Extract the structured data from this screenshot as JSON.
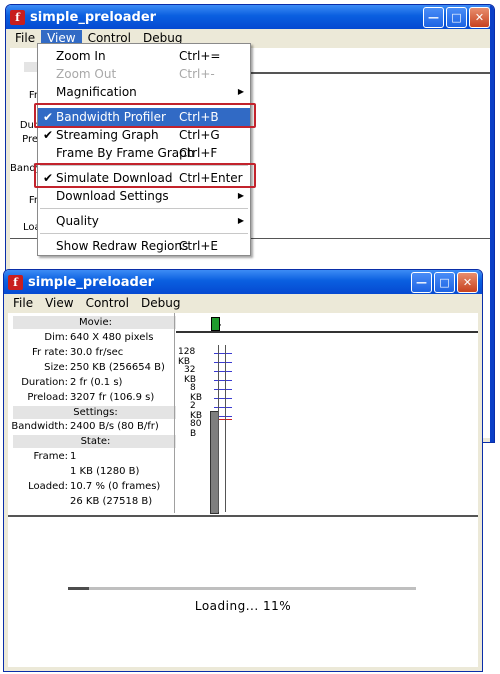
{
  "window": {
    "title": "simple_preloader",
    "menu": [
      "File",
      "View",
      "Control",
      "Debug"
    ]
  },
  "back_window": {
    "partial_labels": [
      "Fr",
      "Dur",
      "Pre",
      "Bandy",
      "Fr",
      "Loa"
    ]
  },
  "view_menu": {
    "items": [
      {
        "label": "Zoom In",
        "shortcut": "Ctrl+=",
        "checked": false,
        "disabled": false,
        "submenu": false
      },
      {
        "label": "Zoom Out",
        "shortcut": "Ctrl+-",
        "checked": false,
        "disabled": true,
        "submenu": false
      },
      {
        "label": "Magnification",
        "shortcut": "",
        "checked": false,
        "disabled": false,
        "submenu": true
      },
      {
        "label": "Bandwidth Profiler",
        "shortcut": "Ctrl+B",
        "checked": true,
        "disabled": false,
        "submenu": false,
        "highlighted": true
      },
      {
        "label": "Streaming Graph",
        "shortcut": "Ctrl+G",
        "checked": true,
        "disabled": false,
        "submenu": false
      },
      {
        "label": "Frame By Frame Graph",
        "shortcut": "Ctrl+F",
        "checked": false,
        "disabled": false,
        "submenu": false
      },
      {
        "label": "Simulate Download",
        "shortcut": "Ctrl+Enter",
        "checked": true,
        "disabled": false,
        "submenu": false
      },
      {
        "label": "Download Settings",
        "shortcut": "",
        "checked": false,
        "disabled": false,
        "submenu": true
      },
      {
        "label": "Quality",
        "shortcut": "",
        "checked": false,
        "disabled": false,
        "submenu": true
      },
      {
        "label": "Show Redraw Regions",
        "shortcut": "Ctrl+E",
        "checked": false,
        "disabled": false,
        "submenu": false
      }
    ]
  },
  "profiler": {
    "movie_header": "Movie:",
    "dim": {
      "label": "Dim:",
      "value": "640 X 480 pixels"
    },
    "fr_rate": {
      "label": "Fr rate:",
      "value": "30.0 fr/sec"
    },
    "size": {
      "label": "Size:",
      "value": "250 KB (256654 B)"
    },
    "duration": {
      "label": "Duration:",
      "value": "2 fr (0.1 s)"
    },
    "preload": {
      "label": "Preload:",
      "value": "3207 fr (106.9 s)"
    },
    "settings_header": "Settings:",
    "bandwidth": {
      "label": "Bandwidth:",
      "value": "2400 B/s (80 B/fr)"
    },
    "state_header": "State:",
    "frame": {
      "label": "Frame:",
      "value": "1"
    },
    "frame_size": "1 KB (1280 B)",
    "loaded": {
      "label": "Loaded:",
      "value": "10.7 % (0 frames)"
    },
    "loaded_size": "26 KB (27518 B)",
    "graph_labels": [
      "128 KB",
      "32 KB",
      "8 KB",
      "2 KB",
      "80 B"
    ]
  },
  "stage": {
    "loading_text": "Loading... 11%",
    "progress_fraction": 0.06
  },
  "colors": {
    "titlebar": "#0a5fe0",
    "highlight": "#316ac5",
    "red_box": "#c2232c",
    "playhead": "#1f9a2e",
    "graph_bar": "#7f7f7f"
  }
}
